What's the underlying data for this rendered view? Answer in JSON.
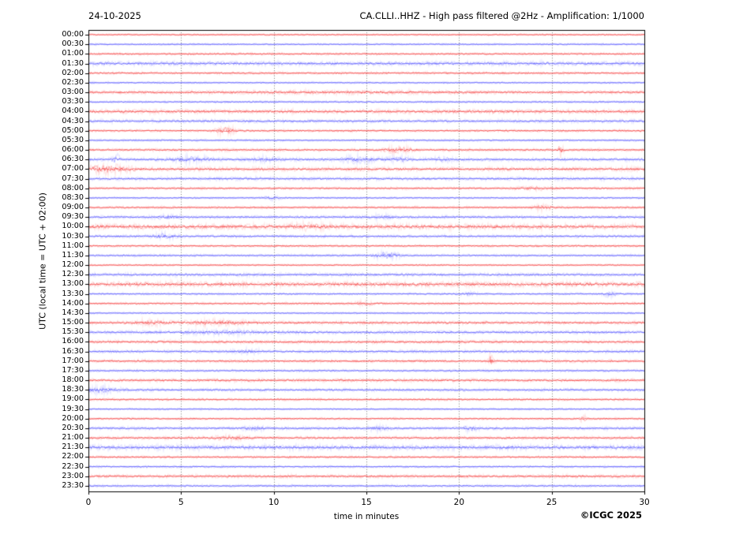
{
  "chart_data": {
    "type": "line",
    "subtype": "helicorder-seismogram",
    "date": "24-10-2025",
    "title": "CA.CLLI..HHZ - High pass filtered @2Hz - Amplification: 1/1000",
    "xlabel": "time in minutes",
    "ylabel": "UTC (local time = UTC + 02:00)",
    "credit": "©ICGC 2025",
    "xlim": [
      0,
      30
    ],
    "xticks": [
      0,
      5,
      10,
      15,
      20,
      25,
      30
    ],
    "grid_minutes": [
      5,
      10,
      15,
      20,
      25
    ],
    "grid_on": true,
    "colors": {
      "red": "#f20000",
      "blue": "#2222ff",
      "frame": "#000000",
      "grid": "#555555",
      "background": "#ffffff"
    },
    "rows": [
      {
        "label": "00:00",
        "color": "red",
        "amp": 0.7,
        "events": []
      },
      {
        "label": "00:30",
        "color": "blue",
        "amp": 0.7,
        "events": []
      },
      {
        "label": "01:00",
        "color": "red",
        "amp": 0.9,
        "events": []
      },
      {
        "label": "01:30",
        "color": "blue",
        "amp": 1.5,
        "events": []
      },
      {
        "label": "02:00",
        "color": "red",
        "amp": 0.9,
        "events": []
      },
      {
        "label": "02:30",
        "color": "blue",
        "amp": 0.7,
        "events": []
      },
      {
        "label": "03:00",
        "color": "red",
        "amp": 1.2,
        "events": [
          {
            "m": 14.0,
            "w": 4.0,
            "a": 0.4
          }
        ]
      },
      {
        "label": "03:30",
        "color": "blue",
        "amp": 0.8,
        "events": []
      },
      {
        "label": "04:00",
        "color": "red",
        "amp": 1.5,
        "events": []
      },
      {
        "label": "04:30",
        "color": "blue",
        "amp": 1.2,
        "events": []
      },
      {
        "label": "05:00",
        "color": "red",
        "amp": 0.9,
        "events": [
          {
            "m": 7.4,
            "w": 0.35,
            "a": 2.6
          }
        ]
      },
      {
        "label": "05:30",
        "color": "blue",
        "amp": 0.8,
        "events": []
      },
      {
        "label": "06:00",
        "color": "red",
        "amp": 1.0,
        "events": [
          {
            "m": 16.7,
            "w": 0.5,
            "a": 2.0
          },
          {
            "m": 25.5,
            "w": 0.1,
            "a": 5.0
          }
        ]
      },
      {
        "label": "06:30",
        "color": "blue",
        "amp": 1.2,
        "events": [
          {
            "m": 1.5,
            "w": 0.15,
            "a": 3.0
          },
          {
            "m": 5.6,
            "w": 0.7,
            "a": 1.8
          },
          {
            "m": 9.6,
            "w": 0.5,
            "a": 1.2
          },
          {
            "m": 14.6,
            "w": 0.7,
            "a": 1.8
          },
          {
            "m": 16.8,
            "w": 0.4,
            "a": 1.5
          },
          {
            "m": 19.2,
            "w": 0.4,
            "a": 1.3
          }
        ]
      },
      {
        "label": "07:00",
        "color": "red",
        "amp": 1.4,
        "events": [
          {
            "m": 0.9,
            "w": 0.9,
            "a": 2.4
          }
        ]
      },
      {
        "label": "07:30",
        "color": "blue",
        "amp": 1.2,
        "events": []
      },
      {
        "label": "08:00",
        "color": "red",
        "amp": 0.9,
        "events": [
          {
            "m": 24.0,
            "w": 0.6,
            "a": 1.0
          }
        ]
      },
      {
        "label": "08:30",
        "color": "blue",
        "amp": 0.7,
        "events": [
          {
            "m": 9.9,
            "w": 0.3,
            "a": 1.2
          }
        ]
      },
      {
        "label": "09:00",
        "color": "red",
        "amp": 0.9,
        "events": [
          {
            "m": 24.5,
            "w": 0.3,
            "a": 1.8
          }
        ]
      },
      {
        "label": "09:30",
        "color": "blue",
        "amp": 1.1,
        "events": [
          {
            "m": 4.3,
            "w": 0.4,
            "a": 1.0
          },
          {
            "m": 15.9,
            "w": 0.4,
            "a": 0.9
          }
        ]
      },
      {
        "label": "10:00",
        "color": "red",
        "amp": 1.9,
        "events": [
          {
            "m": 11.9,
            "w": 0.6,
            "a": 1.3
          }
        ]
      },
      {
        "label": "10:30",
        "color": "blue",
        "amp": 1.1,
        "events": [
          {
            "m": 4.1,
            "w": 0.35,
            "a": 2.0
          }
        ]
      },
      {
        "label": "11:00",
        "color": "red",
        "amp": 0.9,
        "events": []
      },
      {
        "label": "11:30",
        "color": "blue",
        "amp": 0.9,
        "events": [
          {
            "m": 16.1,
            "w": 0.45,
            "a": 2.6
          }
        ]
      },
      {
        "label": "12:00",
        "color": "red",
        "amp": 0.7,
        "events": []
      },
      {
        "label": "12:30",
        "color": "blue",
        "amp": 1.2,
        "events": []
      },
      {
        "label": "13:00",
        "color": "red",
        "amp": 1.9,
        "events": []
      },
      {
        "label": "13:30",
        "color": "blue",
        "amp": 0.8,
        "events": [
          {
            "m": 20.5,
            "w": 0.3,
            "a": 1.0
          },
          {
            "m": 28.1,
            "w": 0.25,
            "a": 1.8
          }
        ]
      },
      {
        "label": "14:00",
        "color": "red",
        "amp": 0.9,
        "events": [
          {
            "m": 14.9,
            "w": 0.4,
            "a": 1.0
          }
        ]
      },
      {
        "label": "14:30",
        "color": "blue",
        "amp": 0.7,
        "events": []
      },
      {
        "label": "15:00",
        "color": "red",
        "amp": 1.2,
        "events": [
          {
            "m": 3.4,
            "w": 0.5,
            "a": 1.7
          },
          {
            "m": 7.0,
            "w": 1.2,
            "a": 1.4
          }
        ]
      },
      {
        "label": "15:30",
        "color": "blue",
        "amp": 1.2,
        "events": [
          {
            "m": 7.5,
            "w": 1.4,
            "a": 1.0
          }
        ]
      },
      {
        "label": "16:00",
        "color": "red",
        "amp": 1.2,
        "events": []
      },
      {
        "label": "16:30",
        "color": "blue",
        "amp": 1.1,
        "events": [
          {
            "m": 8.6,
            "w": 0.5,
            "a": 1.0
          }
        ]
      },
      {
        "label": "17:00",
        "color": "red",
        "amp": 1.1,
        "events": [
          {
            "m": 21.7,
            "w": 0.1,
            "a": 3.8
          }
        ]
      },
      {
        "label": "17:30",
        "color": "blue",
        "amp": 0.9,
        "events": []
      },
      {
        "label": "18:00",
        "color": "red",
        "amp": 1.2,
        "events": []
      },
      {
        "label": "18:30",
        "color": "blue",
        "amp": 1.1,
        "events": [
          {
            "m": 0.6,
            "w": 0.7,
            "a": 2.0
          }
        ]
      },
      {
        "label": "19:00",
        "color": "red",
        "amp": 0.9,
        "events": []
      },
      {
        "label": "19:30",
        "color": "blue",
        "amp": 0.7,
        "events": []
      },
      {
        "label": "20:00",
        "color": "red",
        "amp": 0.8,
        "events": [
          {
            "m": 26.7,
            "w": 0.12,
            "a": 2.2
          }
        ]
      },
      {
        "label": "20:30",
        "color": "blue",
        "amp": 1.1,
        "events": [
          {
            "m": 9.0,
            "w": 0.5,
            "a": 1.1
          },
          {
            "m": 15.7,
            "w": 0.4,
            "a": 1.1
          },
          {
            "m": 20.6,
            "w": 0.3,
            "a": 1.3
          }
        ]
      },
      {
        "label": "21:00",
        "color": "red",
        "amp": 1.1,
        "events": [
          {
            "m": 7.6,
            "w": 0.6,
            "a": 1.2
          }
        ]
      },
      {
        "label": "21:30",
        "color": "blue",
        "amp": 1.8,
        "events": []
      },
      {
        "label": "22:00",
        "color": "red",
        "amp": 0.9,
        "events": []
      },
      {
        "label": "22:30",
        "color": "blue",
        "amp": 0.8,
        "events": []
      },
      {
        "label": "23:00",
        "color": "red",
        "amp": 1.2,
        "events": []
      },
      {
        "label": "23:30",
        "color": "blue",
        "amp": 0.9,
        "events": []
      }
    ]
  }
}
